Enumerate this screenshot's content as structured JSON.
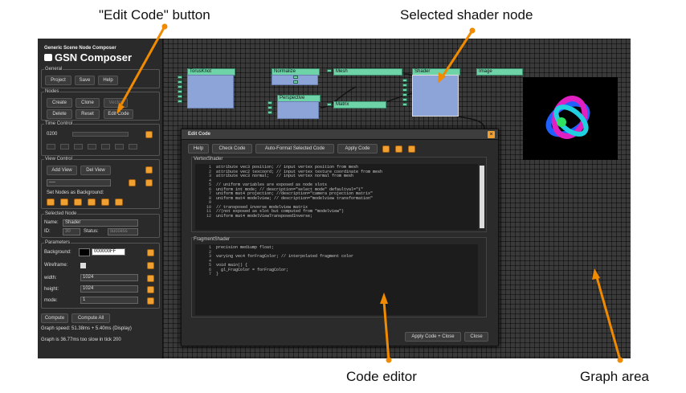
{
  "annotations": {
    "edit_code": "\"Edit Code\" button",
    "selected_node": "Selected shader node",
    "code_editor": "Code editor",
    "graph_area": "Graph area"
  },
  "app": {
    "subtitle": "Generic Scene Node Composer",
    "title": "GSN Composer"
  },
  "general": {
    "title": "General",
    "project": "Project",
    "save": "Save",
    "help": "Help"
  },
  "nodes": {
    "title": "Nodes",
    "create": "Create",
    "clone": "Clone",
    "vectorize": "Vector",
    "delete": "Delete",
    "reset": "Reset",
    "edit_code": "Edit Code"
  },
  "time": {
    "title": "Time Control",
    "value": "0200"
  },
  "view": {
    "title": "View Control",
    "add": "Add View",
    "del": "Del View",
    "select": "----",
    "set_bg": "Set Nodes as Background:"
  },
  "selected_node": {
    "title": "Selected Node",
    "name_label": "Name:",
    "name": "Shader",
    "id_label": "ID:",
    "id": "30",
    "status_label": "Status:",
    "status": "success"
  },
  "params": {
    "title": "Parameters",
    "background_label": "Background:",
    "background_value": "000000FF",
    "wireframe_label": "Wireframe:",
    "width_label": "width:",
    "width": "1024",
    "height_label": "height:",
    "height": "1024",
    "mode_label": "mode:",
    "mode": "1"
  },
  "compute": {
    "compute": "Compute",
    "compute_all": "Compute All",
    "speed": "Graph speed: 51.38ms + 5.40ms (Display)",
    "slow": "Graph is 36.77ms too slow in tick 200"
  },
  "graph_nodes": {
    "torus": "TorusKnot",
    "normalize": "Normalize",
    "mesh": "Mesh",
    "shader": "Shader",
    "image": "Image",
    "perspective": "Perspective",
    "matrix": "Matrix"
  },
  "dialog": {
    "title": "Edit Code",
    "help": "Help",
    "check": "Check Code",
    "autoformat": "Auto-Format Selected Code",
    "apply": "Apply Code",
    "apply_close": "Apply Code + Close",
    "close": "Close",
    "vertex_title": "VertexShader",
    "fragment_title": "FragmentShader"
  },
  "vertex_lines": [
    "attribute vec3 position; // input vertex position from mesh",
    "attribute vec2 texcoord; // input vertex texture coordinate from mesh",
    "attribute vec3 normal;   // input vertex normal from mesh",
    "",
    "// uniform variables are exposed as node slots",
    "uniform int mode; // description=\"select mode\" defaultval=\"1\"",
    "uniform mat4 projection; //description=\"camera projection matrix\"",
    "uniform mat4 modelview; // description=\"modelview transformation\"",
    "",
    "// transposed inverse modelview matrix",
    "//(not exposed as slot but computed from \"modelview\")",
    "uniform mat4 modelViewTransposedInverse;"
  ],
  "fragment_lines": [
    "precision mediump float;",
    "",
    "varying vec4 forFragColor; // interpolated fragment color",
    "",
    "void main() {",
    "  gl_FragColor = forFragColor;",
    "}"
  ],
  "colors": {
    "accent": "#f0a030",
    "node": "#8da4d9",
    "node_title": "#6fd3a8"
  }
}
